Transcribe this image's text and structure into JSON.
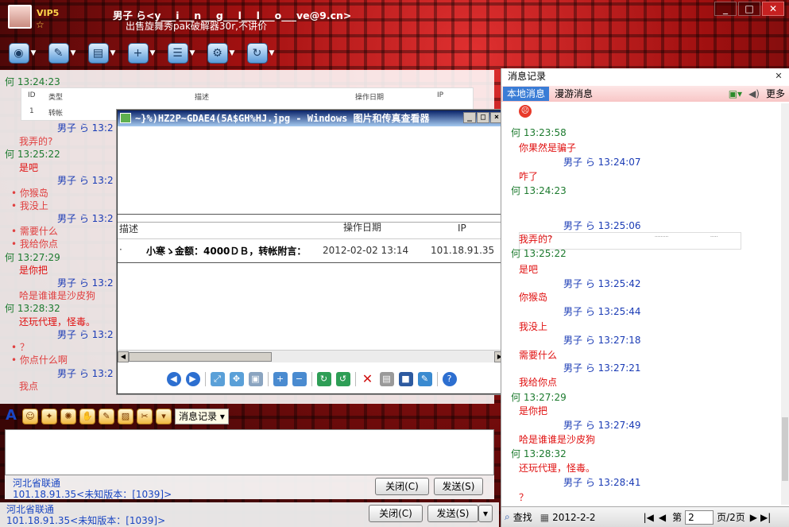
{
  "title": {
    "vip": "VIP5",
    "name": "男子 ら<y___i___n___g___l___l___o___ve@9.cn>",
    "signature": "出售旋舞秀pak破解器30r,不讲价"
  },
  "toolbar": {
    "items": [
      {
        "name": "video-icon",
        "glyph": "◉"
      },
      {
        "name": "microphone-icon",
        "glyph": "✎"
      },
      {
        "name": "folder-icon",
        "glyph": "▤"
      },
      {
        "name": "add-icon",
        "glyph": "+"
      },
      {
        "name": "contact-card-icon",
        "glyph": "☰"
      },
      {
        "name": "settings-icon",
        "glyph": "⚙"
      },
      {
        "name": "refresh-icon",
        "glyph": "↻"
      }
    ]
  },
  "chat": {
    "thumb": {
      "id": "ID",
      "type": "类型",
      "desc": "描述",
      "date": "操作日期",
      "ip": "IP",
      "row_id": "1",
      "row_type": "转帐"
    },
    "messages": [
      {
        "kind": "he",
        "text": "何  13:24:23"
      },
      {
        "kind": "me",
        "text": "男子 ら  13:2"
      },
      {
        "kind": "or",
        "text": "我弄的?"
      },
      {
        "kind": "he",
        "text": "何  13:25:22"
      },
      {
        "kind": "red",
        "text": "是吧"
      },
      {
        "kind": "me",
        "text": "男子 ら  13:2"
      },
      {
        "kind": "bul",
        "text": "• 你猴岛"
      },
      {
        "kind": "bul",
        "text": "• 我没上"
      },
      {
        "kind": "me",
        "text": "男子 ら  13:2"
      },
      {
        "kind": "bul",
        "text": "• 需要什么"
      },
      {
        "kind": "bul",
        "text": "• 我给你点"
      },
      {
        "kind": "he",
        "text": "何  13:27:29"
      },
      {
        "kind": "red",
        "text": "是你把"
      },
      {
        "kind": "me",
        "text": "男子 ら  13:2"
      },
      {
        "kind": "or",
        "text": "哈是谁谁是沙皮狗"
      },
      {
        "kind": "he",
        "text": "何  13:28:32"
      },
      {
        "kind": "red",
        "text": "还玩代理，怪毒。"
      },
      {
        "kind": "me",
        "text": "男子 ら  13:2"
      },
      {
        "kind": "bul",
        "text": "• ？"
      },
      {
        "kind": "bul",
        "text": "• 你点什么啊"
      },
      {
        "kind": "me",
        "text": "男子 ら  13:2"
      },
      {
        "kind": "or",
        "text": "我点"
      }
    ]
  },
  "viewer": {
    "title": "~}%)HZ2P~GDAE4(5A$GH%HJ.jpg - Windows 图片和传真查看器",
    "col_desc": "描述",
    "col_date": "操作日期",
    "col_ip": "IP",
    "row_dot": "·",
    "row_text": "小寒ゝ金额：4000ＤＢ，转帐附言：",
    "row_date": "2012-02-02 13:14",
    "row_ip": "101.18.91.35",
    "minimize": "_",
    "maximize": "□",
    "close": "×"
  },
  "history": {
    "title": "消息记录",
    "tab_local": "本地消息",
    "tab_roam": "漫游消息",
    "more": "更多",
    "messages": [
      {
        "kind": "he",
        "text": "何  13:23:58"
      },
      {
        "kind": "red",
        "text": "你果然是骗子"
      },
      {
        "kind": "me",
        "text": "男子 ら  13:24:07"
      },
      {
        "kind": "red",
        "text": "咋了"
      },
      {
        "kind": "he",
        "text": "何  13:24:23"
      },
      {
        "kind": "me",
        "text": "男子 ら  13:25:06"
      },
      {
        "kind": "red",
        "text": "我弄的?"
      },
      {
        "kind": "he",
        "text": "何  13:25:22"
      },
      {
        "kind": "red",
        "text": "是吧"
      },
      {
        "kind": "me",
        "text": "男子 ら  13:25:42"
      },
      {
        "kind": "red",
        "text": "你猴岛"
      },
      {
        "kind": "me",
        "text": "男子 ら  13:25:44"
      },
      {
        "kind": "red",
        "text": "我没上"
      },
      {
        "kind": "me",
        "text": "男子 ら  13:27:18"
      },
      {
        "kind": "red",
        "text": "需要什么"
      },
      {
        "kind": "me",
        "text": "男子 ら  13:27:21"
      },
      {
        "kind": "red",
        "text": "我给你点"
      },
      {
        "kind": "he",
        "text": "何  13:27:29"
      },
      {
        "kind": "red",
        "text": "是你把"
      },
      {
        "kind": "me",
        "text": "男子 ら  13:27:49"
      },
      {
        "kind": "red",
        "text": "哈是谁谁是沙皮狗"
      },
      {
        "kind": "he",
        "text": "何  13:28:32"
      },
      {
        "kind": "red",
        "text": "还玩代理，怪毒。"
      },
      {
        "kind": "me",
        "text": "男子 ら  13:28:41"
      },
      {
        "kind": "red",
        "text": "？"
      }
    ],
    "search": "查找",
    "date": "2012-2-2",
    "page_prefix": "第",
    "page_value": "2",
    "page_suffix": "页/2页"
  },
  "input": {
    "history_button": "消息记录",
    "close": "关闭(C)",
    "send": "发送(S)"
  },
  "status": {
    "region": "河北省联通",
    "ipinfo": "101.18.91.35<未知版本：[1039]>"
  }
}
